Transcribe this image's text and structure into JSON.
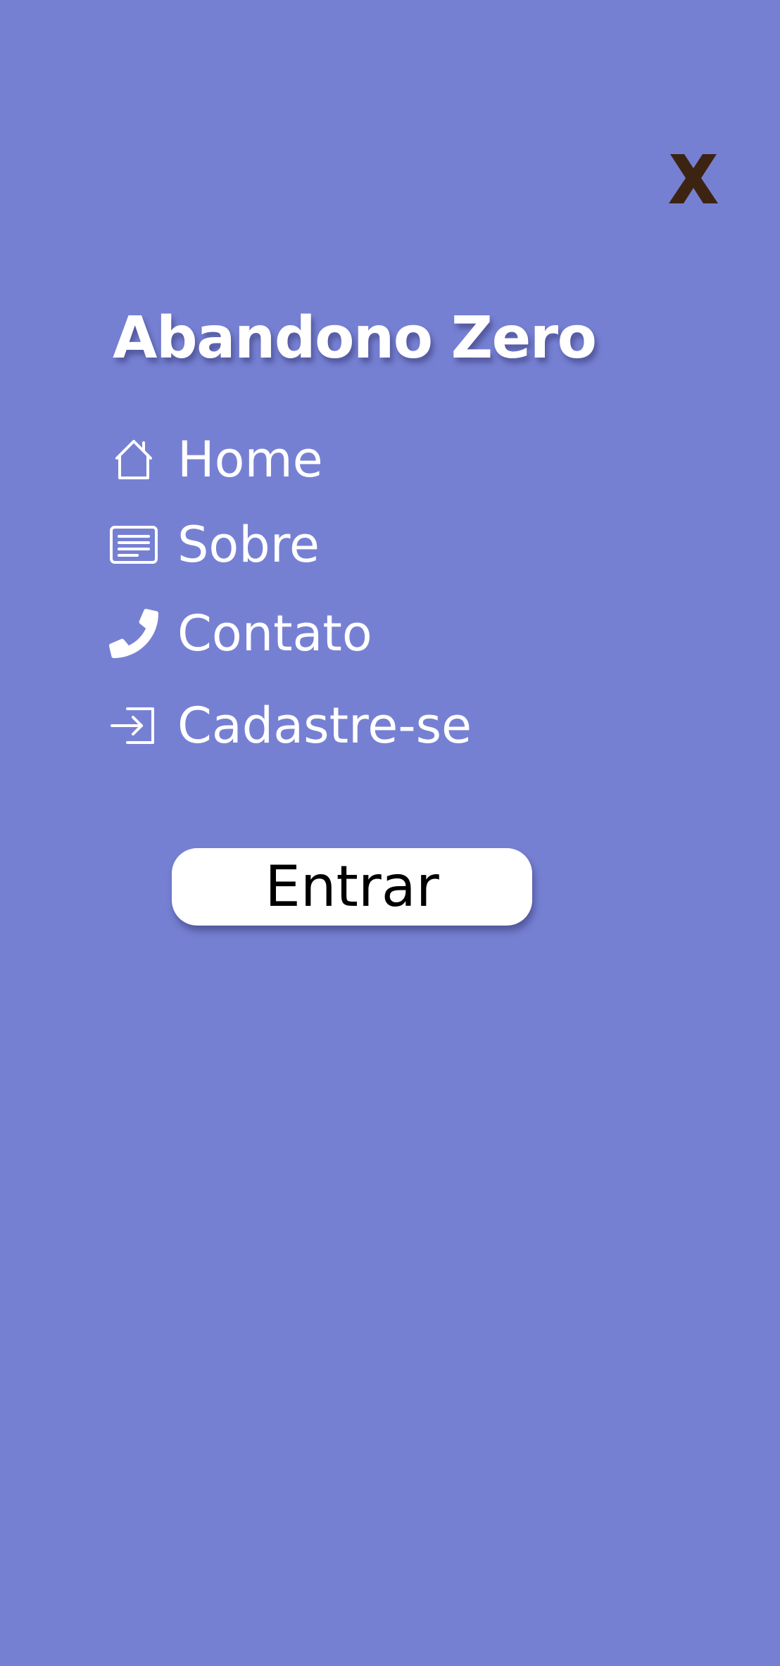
{
  "colors": {
    "background": "#7680d3",
    "text": "#ffffff",
    "close_icon": "#3d2412",
    "button_bg": "#ffffff",
    "button_text": "#000000"
  },
  "menu": {
    "close_icon": "close-x-icon",
    "title": "Abandono Zero",
    "items": [
      {
        "label": "Home",
        "icon": "home-icon"
      },
      {
        "label": "Sobre",
        "icon": "newspaper-icon"
      },
      {
        "label": "Contato",
        "icon": "phone-icon"
      },
      {
        "label": "Cadastre-se",
        "icon": "sign-in-icon"
      }
    ],
    "login_label": "Entrar"
  }
}
